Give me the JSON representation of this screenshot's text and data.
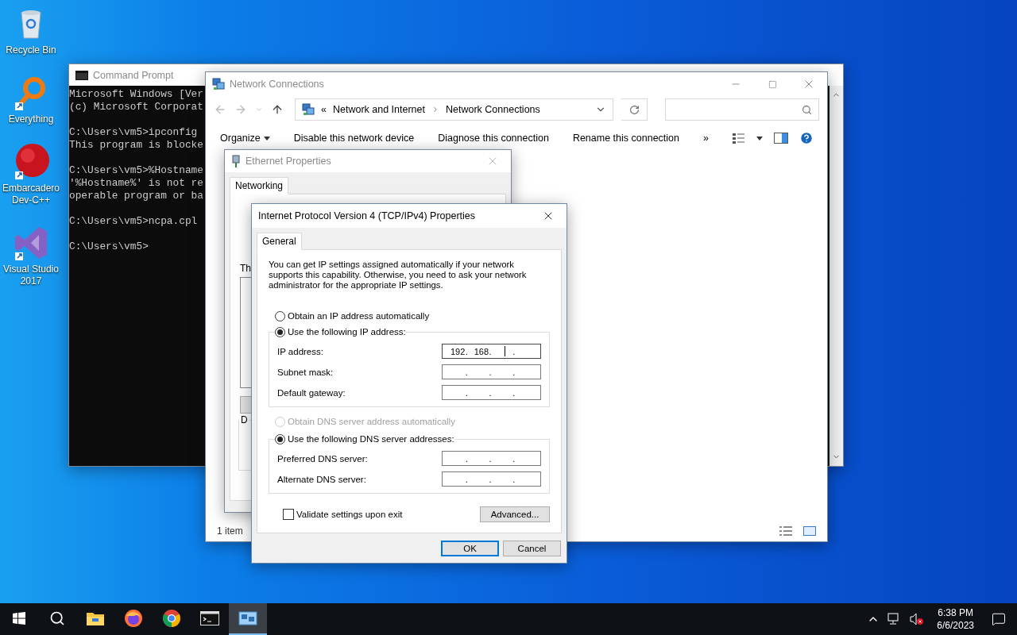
{
  "desktop_icons": [
    {
      "label": "Recycle Bin",
      "kind": "recycle"
    },
    {
      "label": "Everything",
      "kind": "everything"
    },
    {
      "label": "Embarcadero Dev-C++",
      "kind": "devcpp"
    },
    {
      "label": "Visual Studio 2017",
      "kind": "vs"
    }
  ],
  "command_prompt": {
    "title": "Command Prompt",
    "blocks": [
      [
        "Microsoft Windows [Ver",
        "(c) Microsoft Corporat"
      ],
      [
        "C:\\Users\\vm5>ipconfig",
        "This program is blocke"
      ],
      [
        "C:\\Users\\vm5>%Hostname",
        "'%Hostname%' is not re",
        "operable program or ba"
      ],
      [
        "C:\\Users\\vm5>ncpa.cpl"
      ],
      [
        "C:\\Users\\vm5>"
      ]
    ]
  },
  "network_connections": {
    "title": "Network Connections",
    "address_overflow": "«",
    "breadcrumb": [
      "Network and Internet",
      "Network Connections"
    ],
    "toolbar": [
      {
        "label": "Organize",
        "kind": "menu"
      },
      {
        "label": "Disable this network device",
        "kind": "command"
      },
      {
        "label": "Diagnose this connection",
        "kind": "command"
      },
      {
        "label": "Rename this connection",
        "kind": "command"
      }
    ],
    "more": "»",
    "status": "1 item"
  },
  "ethernet_properties": {
    "title": "Ethernet Properties",
    "tabs": [
      {
        "label": "Networking",
        "selected": true
      }
    ],
    "list_label": "Th",
    "group_label": "D"
  },
  "ipv4_dialog": {
    "title": "Internet Protocol Version 4 (TCP/IPv4) Properties",
    "tabs": [
      {
        "label": "General",
        "selected": true
      }
    ],
    "description": "You can get IP settings assigned automatically if your network supports this capability. Otherwise, you need to ask your network administrator for the appropriate IP settings.",
    "separator": ".",
    "ip_options": [
      {
        "label": "Obtain an IP address automatically",
        "selected": false,
        "disabled": false
      },
      {
        "label": "Use the following IP address:",
        "selected": true,
        "disabled": false
      }
    ],
    "ip_fields": [
      {
        "label": "IP address:",
        "octets": [
          "192",
          "168"
        ],
        "focused": true
      },
      {
        "label": "Subnet mask:",
        "focused": false
      },
      {
        "label": "Default gateway:",
        "focused": false
      }
    ],
    "dns_options": [
      {
        "label": "Obtain DNS server address automatically",
        "selected": false,
        "disabled": true
      },
      {
        "label": "Use the following DNS server addresses:",
        "selected": true,
        "disabled": false
      }
    ],
    "dns_fields": [
      {
        "label": "Preferred DNS server:",
        "focused": false
      },
      {
        "label": "Alternate DNS server:",
        "focused": false
      }
    ],
    "validate": {
      "label": "Validate settings upon exit",
      "checked": false
    },
    "advanced": "Advanced...",
    "buttons": [
      {
        "label": "OK",
        "kind": "default"
      },
      {
        "label": "Cancel",
        "kind": "normal"
      }
    ]
  },
  "taskbar": {
    "apps": [
      {
        "kind": "explorer",
        "active": false
      },
      {
        "kind": "firefox",
        "active": false
      },
      {
        "kind": "chrome",
        "active": false
      },
      {
        "kind": "terminal",
        "active": false
      },
      {
        "kind": "network",
        "active": true
      }
    ],
    "time": "6:38 PM",
    "date": "6/6/2023"
  }
}
